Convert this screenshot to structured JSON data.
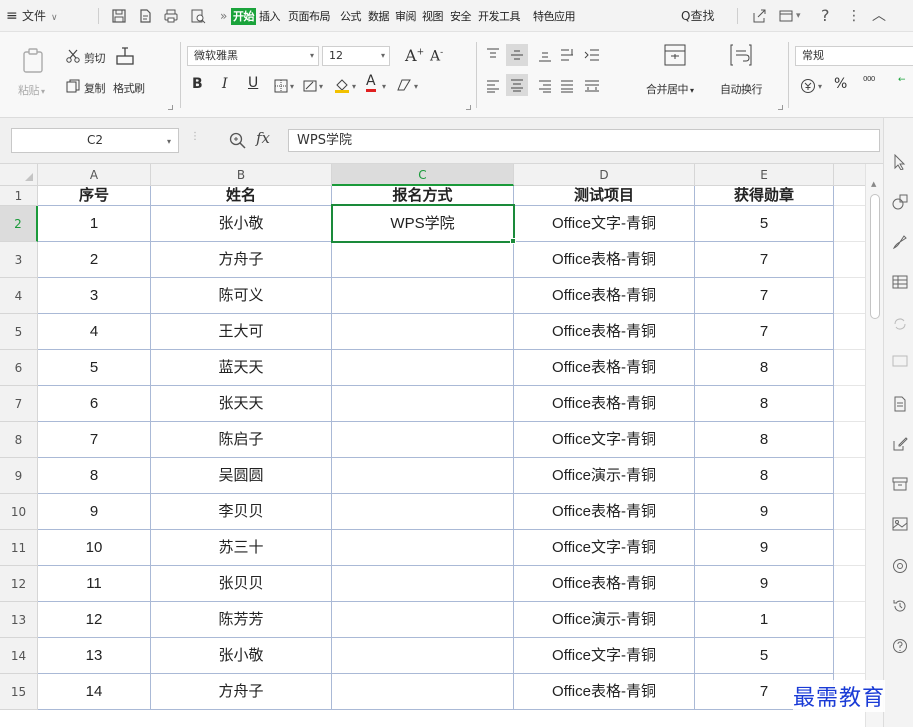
{
  "menubar": {
    "file_label": "文件",
    "expand_label": "»",
    "tabs": [
      {
        "label": "开始",
        "active": true
      },
      {
        "label": "插入"
      },
      {
        "label": "页面布局"
      },
      {
        "label": "公式"
      },
      {
        "label": "数据"
      },
      {
        "label": "审阅"
      },
      {
        "label": "视图"
      },
      {
        "label": "安全"
      },
      {
        "label": "开发工具"
      },
      {
        "label": "特色应用"
      }
    ],
    "search_label": "Q查找",
    "help_label": "?",
    "more_label": "⋮",
    "collapse_label": "︿"
  },
  "ribbon": {
    "paste_label": "粘贴",
    "cut_label": "剪切",
    "copy_label": "复制",
    "format_painter_label": "格式刷",
    "font_name": "微软雅黑",
    "font_size": "12",
    "bold_label": "B",
    "italic_label": "I",
    "underline_label": "U",
    "grow_font_label": "A",
    "shrink_font_label": "A",
    "merge_center_label": "合并居中",
    "wrap_text_label": "自动换行",
    "number_format": "常规",
    "percent_label": "%",
    "thousands_label": "000"
  },
  "formula_bar": {
    "cell_ref": "C2",
    "fx_label": "fx",
    "content": "WPS学院"
  },
  "sheet": {
    "columns": [
      "A",
      "B",
      "C",
      "D",
      "E"
    ],
    "selected_column": "C",
    "selected_row": "2",
    "row_numbers": [
      "1",
      "2",
      "3",
      "4",
      "5",
      "6",
      "7",
      "8",
      "9",
      "10",
      "11",
      "12",
      "13",
      "14",
      "15"
    ],
    "header": [
      "序号",
      "姓名",
      "报名方式",
      "测试项目",
      "获得勋章"
    ],
    "rows": [
      [
        "1",
        "张小敬",
        "WPS学院",
        "Office文字-青铜",
        "5"
      ],
      [
        "2",
        "方舟子",
        "",
        "Office表格-青铜",
        "7"
      ],
      [
        "3",
        "陈可义",
        "",
        "Office表格-青铜",
        "7"
      ],
      [
        "4",
        "王大可",
        "",
        "Office表格-青铜",
        "7"
      ],
      [
        "5",
        "蓝天天",
        "",
        "Office表格-青铜",
        "8"
      ],
      [
        "6",
        "张天天",
        "",
        "Office表格-青铜",
        "8"
      ],
      [
        "7",
        "陈启子",
        "",
        "Office文字-青铜",
        "8"
      ],
      [
        "8",
        "吴圆圆",
        "",
        "Office演示-青铜",
        "8"
      ],
      [
        "9",
        "李贝贝",
        "",
        "Office表格-青铜",
        "9"
      ],
      [
        "10",
        "苏三十",
        "",
        "Office文字-青铜",
        "9"
      ],
      [
        "11",
        "张贝贝",
        "",
        "Office表格-青铜",
        "9"
      ],
      [
        "12",
        "陈芳芳",
        "",
        "Office演示-青铜",
        "1"
      ],
      [
        "13",
        "张小敬",
        "",
        "Office文字-青铜",
        "5"
      ],
      [
        "14",
        "方舟子",
        "",
        "Office表格-青铜",
        "7"
      ]
    ]
  },
  "watermark": "最需教育",
  "colors": {
    "accent_green": "#1aa33b",
    "cell_border": "#aab9d6",
    "watermark_blue": "#1a3bd6"
  }
}
